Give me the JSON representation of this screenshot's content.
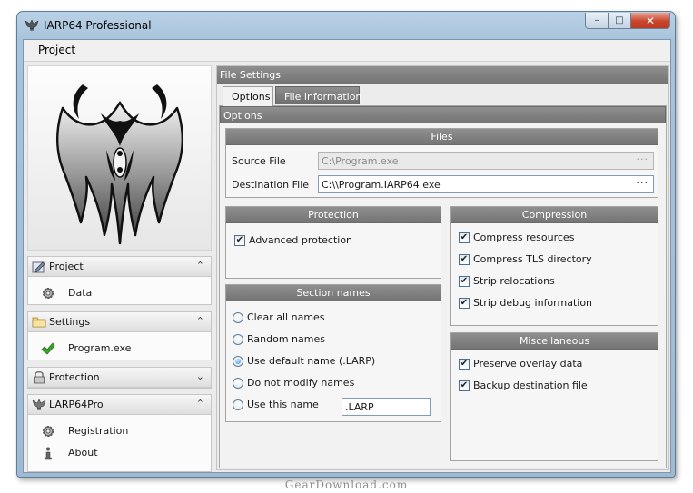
{
  "window": {
    "title": "IARP64 Professional"
  },
  "menu": {
    "items": [
      "Project"
    ]
  },
  "sidebar": {
    "groups": [
      {
        "title": "Project",
        "icon": "project-icon",
        "chevron": "up",
        "items": [
          {
            "label": "Data",
            "icon": "gear-icon"
          }
        ]
      },
      {
        "title": "Settings",
        "icon": "folder-icon",
        "chevron": "up",
        "items": [
          {
            "label": "Program.exe",
            "icon": "checkmark-icon"
          }
        ]
      },
      {
        "title": "Protection",
        "icon": "lock-icon",
        "chevron": "down",
        "items": []
      },
      {
        "title": "LARP64Pro",
        "icon": "app-logo-icon",
        "chevron": "up",
        "items": [
          {
            "label": "Registration",
            "icon": "gear-icon"
          },
          {
            "label": "About",
            "icon": "info-icon"
          }
        ]
      }
    ]
  },
  "file_settings": {
    "title": "File Settings",
    "tabs": [
      {
        "label": "Options",
        "active": true
      },
      {
        "label": "File information",
        "active": false
      }
    ],
    "options_title": "Options",
    "files": {
      "title": "Files",
      "source_label": "Source File",
      "source_value": "C:\\Program.exe",
      "dest_label": "Destination File",
      "dest_value": "C:\\\\Program.IARP64.exe",
      "browse": "···"
    },
    "protection": {
      "title": "Protection",
      "items": [
        {
          "label": "Advanced protection",
          "checked": true
        }
      ]
    },
    "compression": {
      "title": "Compression",
      "items": [
        {
          "label": "Compress resources",
          "checked": true
        },
        {
          "label": "Compress TLS directory",
          "checked": true
        },
        {
          "label": "Strip relocations",
          "checked": true
        },
        {
          "label": "Strip debug information",
          "checked": true
        }
      ]
    },
    "section_names": {
      "title": "Section names",
      "options": [
        {
          "label": "Clear all names",
          "selected": false
        },
        {
          "label": "Random names",
          "selected": false
        },
        {
          "label": "Use default name (.LARP)",
          "selected": true
        },
        {
          "label": "Do not modify names",
          "selected": false
        },
        {
          "label": "Use this name",
          "selected": false
        }
      ],
      "custom_name_value": ".LARP"
    },
    "miscellaneous": {
      "title": "Miscellaneous",
      "items": [
        {
          "label": "Preserve overlay data",
          "checked": true
        },
        {
          "label": "Backup destination file",
          "checked": true
        }
      ]
    }
  },
  "watermark": "GearDownload.com",
  "colors": {
    "section_bar": "#808080",
    "window_frame": "#a8c4dc",
    "close_button": "#c9462c",
    "panel_bg": "#f2f2f2"
  }
}
